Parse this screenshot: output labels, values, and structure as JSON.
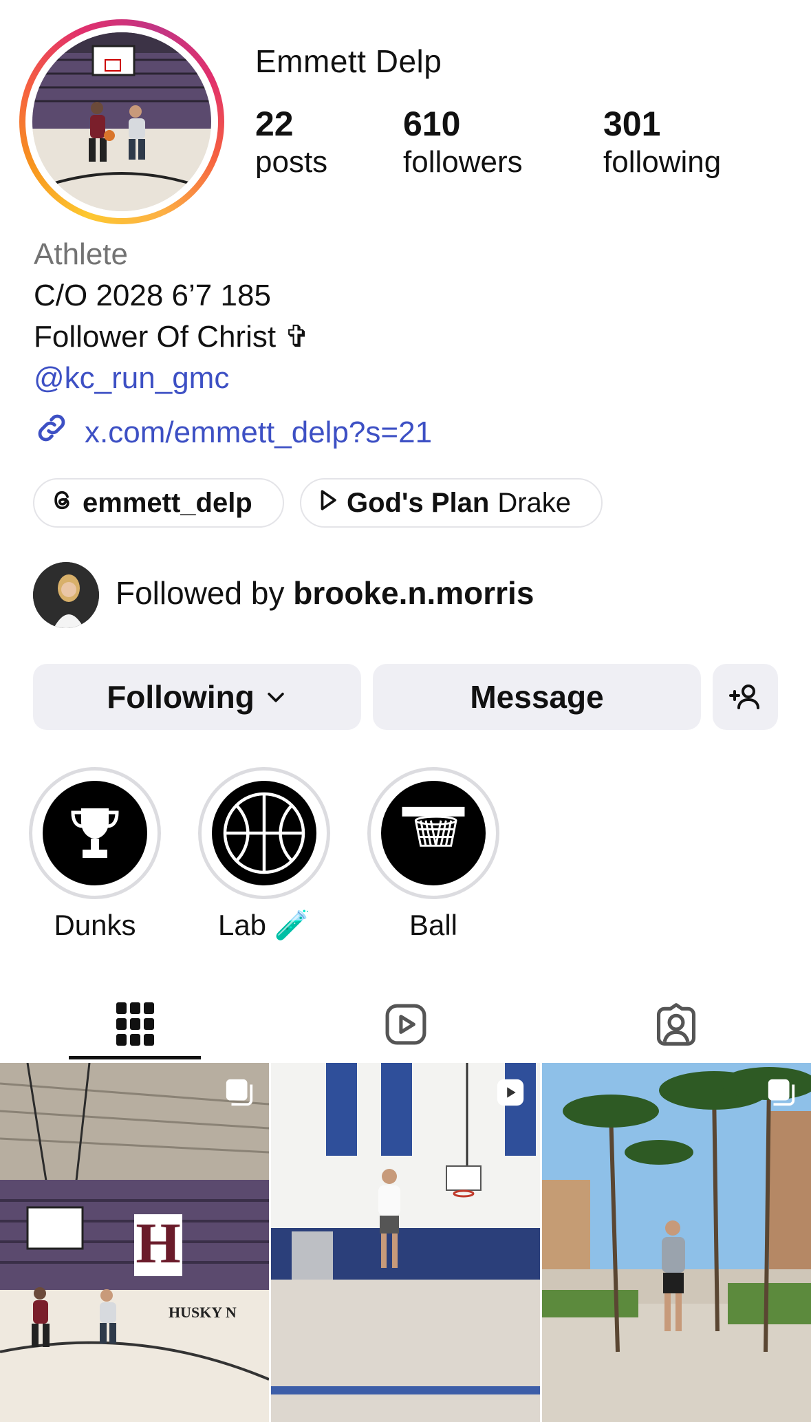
{
  "profile": {
    "username": "Emmett Delp",
    "stats": [
      {
        "value": "22",
        "label": "posts"
      },
      {
        "value": "610",
        "label": "followers"
      },
      {
        "value": "301",
        "label": "following"
      }
    ]
  },
  "bio": {
    "category": "Athlete",
    "line1": "C/O 2028 6’7 185",
    "line2": "Follower Of Christ ✞",
    "mention": "@kc_run_gmc",
    "link": "x.com/emmett_delp?s=21"
  },
  "pills": {
    "threads": {
      "handle": "emmett_delp",
      "icon": "threads-icon"
    },
    "music": {
      "song": "God's Plan",
      "artist": "Drake",
      "icon": "play-icon"
    }
  },
  "followed_by": {
    "prefix": "Followed by",
    "name": "brooke.n.morris"
  },
  "actions": {
    "following_label": "Following",
    "message_label": "Message",
    "add_user_icon": "add-user-icon"
  },
  "highlights": [
    {
      "label": "Dunks",
      "icon": "trophy-icon"
    },
    {
      "label": "Lab 🧪",
      "icon": "basketball-icon"
    },
    {
      "label": "Ball",
      "icon": "hoop-icon"
    }
  ],
  "tabs": [
    {
      "name": "grid",
      "icon": "grid-icon",
      "active": true
    },
    {
      "name": "reels",
      "icon": "reels-icon",
      "active": false
    },
    {
      "name": "tagged",
      "icon": "tagged-icon",
      "active": false
    }
  ],
  "grid": [
    {
      "type": "carousel",
      "badge": "carousel-icon",
      "caption": "HUSKY N"
    },
    {
      "type": "reel",
      "badge": "reel-icon"
    },
    {
      "type": "carousel",
      "badge": "carousel-icon"
    }
  ],
  "colors": {
    "link": "#3d50c4",
    "button_bg": "#efeff4",
    "category": "#737373"
  }
}
